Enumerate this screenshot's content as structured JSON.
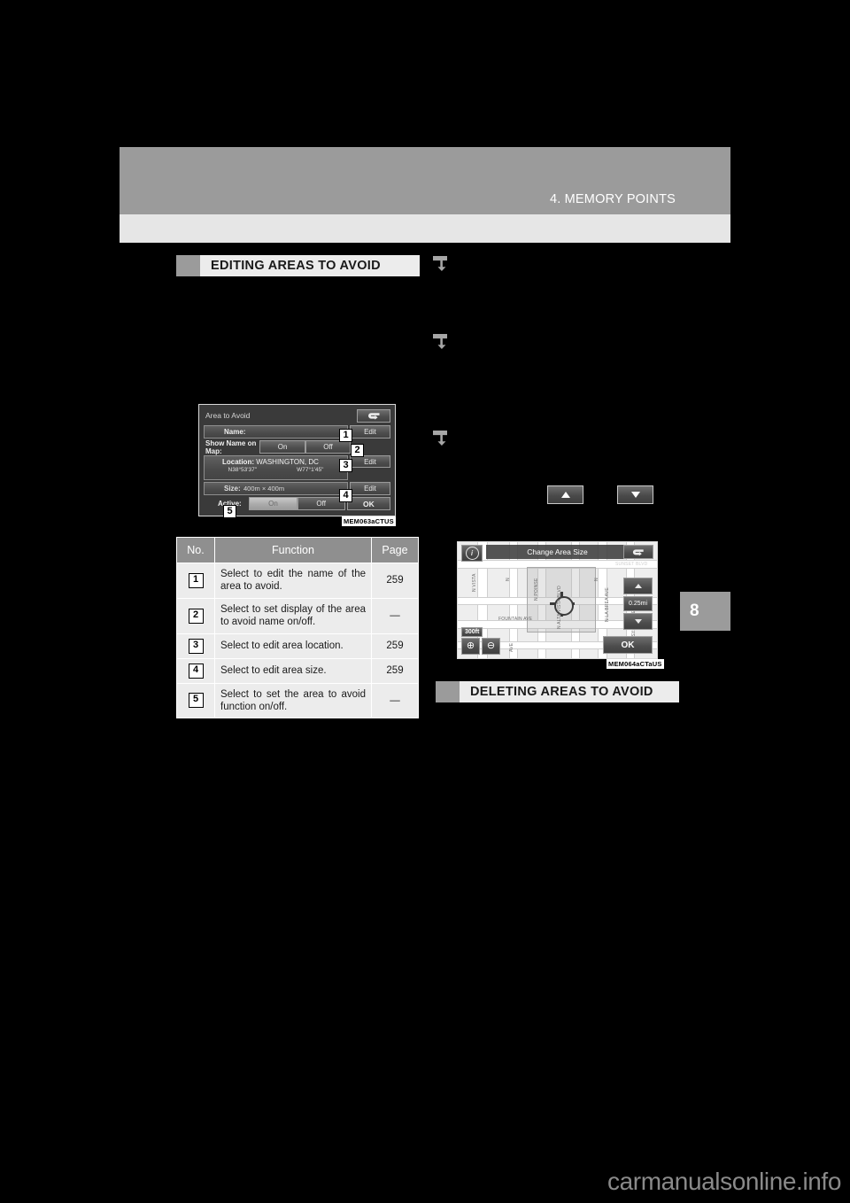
{
  "page": {
    "chapter_number": "8",
    "header_title": "4. MEMORY POINTS",
    "watermark": "carmanualsonline.info"
  },
  "sections": [
    {
      "id": "editing",
      "title": "EDITING AREAS TO AVOID"
    },
    {
      "id": "deleting",
      "title": "DELETING AREAS TO AVOID"
    }
  ],
  "step_markers": [
    {
      "name": "step-marker-1"
    },
    {
      "name": "step-marker-2"
    },
    {
      "name": "step-marker-3"
    }
  ],
  "inline_buttons": [
    {
      "icon": "triangle-up-icon"
    },
    {
      "icon": "triangle-down-icon"
    }
  ],
  "figure_area_to_avoid": {
    "caption": "MEM063aCTUS",
    "title": "Area to Avoid",
    "back_icon": "back-arrow-icon",
    "rows": {
      "name": {
        "label": "Name:",
        "value": "",
        "edit_label": "Edit",
        "callout": "1"
      },
      "show_name_on_map": {
        "label": "Show Name on Map:",
        "on_label": "On",
        "off_label": "Off",
        "selected": "Off",
        "callout": "2"
      },
      "location": {
        "label": "Location:",
        "value": "WASHINGTON, DC",
        "latitude": "N38°53'37\"",
        "longitude": "W77°1'45\"",
        "edit_label": "Edit",
        "callout": "3"
      },
      "size": {
        "label": "Size:",
        "value": "400m × 400m",
        "edit_label": "Edit",
        "callout": "4"
      },
      "active": {
        "label": "Active:",
        "on_label": "On",
        "off_label": "Off",
        "selected": "On",
        "callout": "5"
      },
      "ok": {
        "label": "OK"
      }
    }
  },
  "figure_change_area_size": {
    "caption": "MEM064aCTaUS",
    "title": "Change Area Size",
    "info_icon": "info-icon",
    "back_icon": "back-arrow-icon",
    "scale_up_icon": "triangle-up-icon",
    "scale_down_icon": "triangle-down-icon",
    "scale_value": "0.25mi",
    "zoom_level": "300ft",
    "zoom_in_label": "⊕",
    "zoom_out_label": "⊖",
    "ok_label": "OK",
    "crosshair_icon": "crosshair-icon",
    "map_labels": [
      "N VISTA",
      "N",
      "N POINSE",
      "N ALTA VISTA BLVD",
      "N",
      "N LA BREA AVE",
      "N SYCAMORE AVE",
      "FOUNTAIN AVE",
      "SUNSET BLVD",
      "AVE"
    ]
  },
  "function_table": {
    "headers": [
      "No.",
      "Function",
      "Page"
    ],
    "rows": [
      {
        "no": "1",
        "function": "Select to edit the name of the area to avoid.",
        "page": "259"
      },
      {
        "no": "2",
        "function": "Select to set display of the area to avoid name on/off.",
        "page": "—"
      },
      {
        "no": "3",
        "function": "Select to edit area location.",
        "page": "259"
      },
      {
        "no": "4",
        "function": "Select to edit area size.",
        "page": "259"
      },
      {
        "no": "5",
        "function": "Select to set the area to avoid function on/off.",
        "page": "—"
      }
    ]
  }
}
